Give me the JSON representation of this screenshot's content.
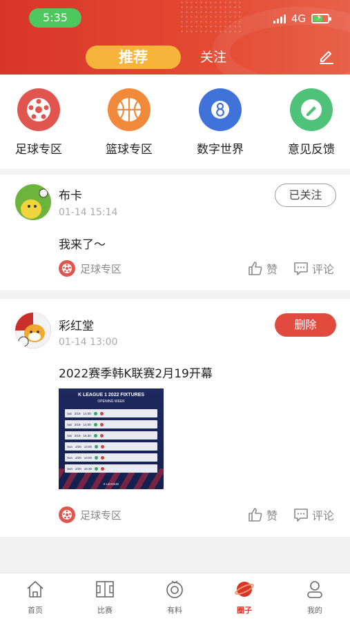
{
  "status_bar": {
    "time": "5:35",
    "network": "4G"
  },
  "header": {
    "tab_recommend": "推荐",
    "tab_follow": "关注"
  },
  "categories": [
    {
      "label": "足球专区",
      "icon": "soccer-ball-icon",
      "color": "#e0554d"
    },
    {
      "label": "篮球专区",
      "icon": "basketball-icon",
      "color": "#f0893a"
    },
    {
      "label": "数字世界",
      "icon": "eight-ball-icon",
      "color": "#3f73d9"
    },
    {
      "label": "意见反馈",
      "icon": "feedback-pencil-icon",
      "color": "#4fc27a"
    }
  ],
  "posts": [
    {
      "username": "布卡",
      "date": "01-14 15:14",
      "text": "我来了～",
      "button": "已关注",
      "topic": "足球专区",
      "like_label": "赞",
      "comment_label": "评论"
    },
    {
      "username": "彩红堂",
      "date": "01-14 13:00",
      "text": "2022赛季韩K联赛2月19开幕",
      "button": "删除",
      "topic": "足球专区",
      "like_label": "赞",
      "comment_label": "评论",
      "image": {
        "title": "K LEAGUE 1  2022 FIXTURES",
        "subtitle": "OPENING WEEK",
        "footer": "K LEAGUE",
        "rows": [
          {
            "day": "Sat",
            "date": "2/19",
            "time": "14:00"
          },
          {
            "day": "Sat",
            "date": "2/19",
            "time": "14:00"
          },
          {
            "day": "Sat",
            "date": "2/19",
            "time": "16:30"
          },
          {
            "day": "Sun",
            "date": "2/20",
            "time": "14:00"
          },
          {
            "day": "Sun",
            "date": "2/20",
            "time": "14:00"
          },
          {
            "day": "Sun",
            "date": "2/20",
            "time": "16:30"
          }
        ]
      }
    }
  ],
  "tabbar": [
    {
      "label": "首页",
      "icon": "home-icon"
    },
    {
      "label": "比赛",
      "icon": "court-icon"
    },
    {
      "label": "有料",
      "icon": "radar-icon"
    },
    {
      "label": "圈子",
      "icon": "planet-icon",
      "active": true
    },
    {
      "label": "我的",
      "icon": "profile-icon"
    }
  ],
  "colors": {
    "brand_red": "#d8352a",
    "tab_orange": "#f6b43a",
    "delete_red": "#e04a3f"
  }
}
